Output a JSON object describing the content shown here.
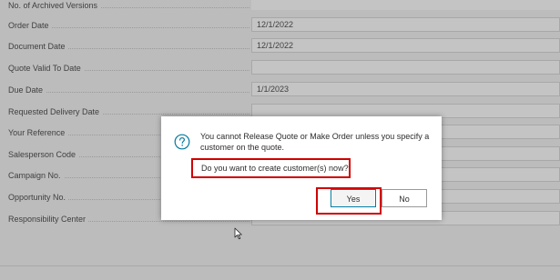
{
  "form": {
    "fields": [
      {
        "label": "No. of Archived Versions",
        "value": ""
      },
      {
        "label": "Order Date",
        "value": "12/1/2022"
      },
      {
        "label": "Document Date",
        "value": "12/1/2022"
      },
      {
        "label": "Quote Valid To Date",
        "value": ""
      },
      {
        "label": "Due Date",
        "value": "1/1/2023"
      },
      {
        "label": "Requested Delivery Date",
        "value": ""
      },
      {
        "label": "Your Reference",
        "value": ""
      },
      {
        "label": "Salesperson Code",
        "value": ""
      },
      {
        "label": "Campaign No.",
        "value": ""
      },
      {
        "label": "Opportunity No.",
        "value": ""
      },
      {
        "label": "Responsibility Center",
        "value": ""
      }
    ]
  },
  "dialog": {
    "icon": "question-circle-icon",
    "message": "You cannot Release Quote or Make Order unless you specify a customer on the quote.",
    "question": "Do you want to create customer(s) now?",
    "yes_label": "Yes",
    "no_label": "No",
    "highlight_color": "#d00000",
    "accent_color": "#00799e"
  }
}
